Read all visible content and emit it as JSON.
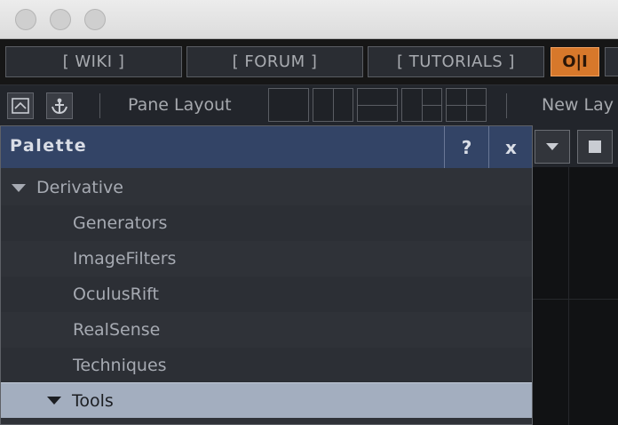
{
  "window": {
    "controls": [
      "close",
      "minimize",
      "zoom"
    ]
  },
  "linkbar": {
    "wiki_label": "[ WIKI ]",
    "forum_label": "[ FORUM ]",
    "tutorials_label": "[ TUTORIALS ]",
    "oi_label": "O|I"
  },
  "toolbar": {
    "pane_layout_label": "Pane Layout",
    "new_layout_label": "New Lay"
  },
  "palette": {
    "title": "Palette",
    "help_label": "?",
    "close_label": "x",
    "items": [
      {
        "label": "Derivative",
        "expanded": true
      },
      {
        "label": "Generators"
      },
      {
        "label": "ImageFilters"
      },
      {
        "label": "OculusRift"
      },
      {
        "label": "RealSense"
      },
      {
        "label": "Techniques"
      },
      {
        "label": "Tools",
        "expanded": true,
        "selected": true
      }
    ]
  },
  "colors": {
    "accent_orange": "#d7782b",
    "palette_header": "#334466",
    "selection": "#a3aebf"
  }
}
